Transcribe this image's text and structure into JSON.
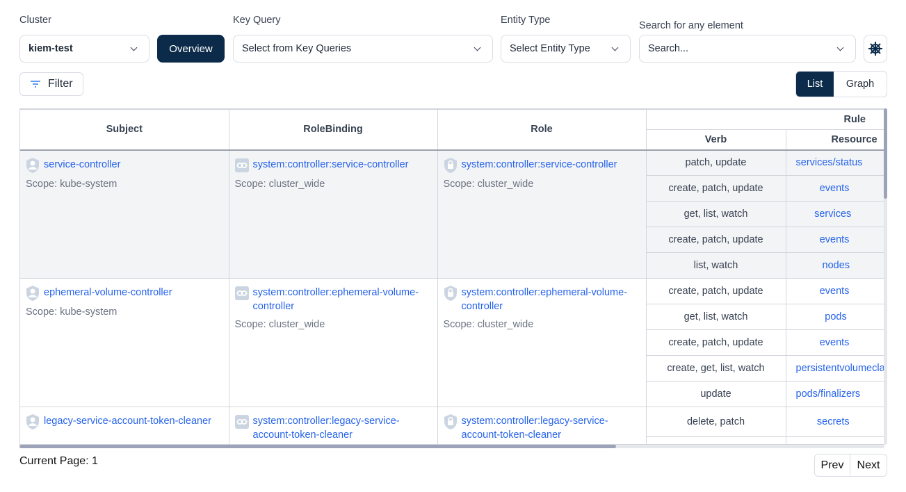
{
  "filters": {
    "cluster": {
      "label": "Cluster",
      "value": "kiem-test"
    },
    "overview_label": "Overview",
    "key_query": {
      "label": "Key Query",
      "placeholder": "Select from Key Queries"
    },
    "entity_type": {
      "label": "Entity Type",
      "placeholder": "Select Entity Type"
    },
    "search": {
      "label": "Search for any element",
      "placeholder": "Search..."
    },
    "helm_icon": "kubernetes-helm-icon"
  },
  "toolbar": {
    "filter_label": "Filter",
    "view_list": "List",
    "view_graph": "Graph",
    "active_view": "List"
  },
  "table": {
    "headers": {
      "subject": "Subject",
      "rolebinding": "RoleBinding",
      "role": "Role",
      "rule": "Rule",
      "verb": "Verb",
      "resource": "Resource"
    },
    "groups": [
      {
        "subject": "service-controller",
        "subject_scope": "Scope: kube-system",
        "rolebinding": "system:controller:service-controller",
        "rolebinding_scope": "Scope: cluster_wide",
        "role": "system:controller:service-controller",
        "role_scope": "Scope: cluster_wide",
        "rules": [
          {
            "verb": "patch, update",
            "resource": "services/status"
          },
          {
            "verb": "create, patch, update",
            "resource": "events"
          },
          {
            "verb": "get, list, watch",
            "resource": "services"
          },
          {
            "verb": "create, patch, update",
            "resource": "events"
          },
          {
            "verb": "list, watch",
            "resource": "nodes"
          }
        ]
      },
      {
        "subject": "ephemeral-volume-controller",
        "subject_scope": "Scope: kube-system",
        "rolebinding": "system:controller:ephemeral-volume-controller",
        "rolebinding_scope": "Scope: cluster_wide",
        "role": "system:controller:ephemeral-volume-controller",
        "role_scope": "Scope: cluster_wide",
        "rules": [
          {
            "verb": "create, patch, update",
            "resource": "events"
          },
          {
            "verb": "get, list, watch",
            "resource": "pods"
          },
          {
            "verb": "create, patch, update",
            "resource": "events"
          },
          {
            "verb": "create, get, list, watch",
            "resource": "persistentvolumeclaims"
          },
          {
            "verb": "update",
            "resource": "pods/finalizers"
          }
        ]
      },
      {
        "subject": "legacy-service-account-token-cleaner",
        "rolebinding": "system:controller:legacy-service-account-token-cleaner",
        "role": "system:controller:legacy-service-account-token-cleaner",
        "rules": [
          {
            "verb": "delete, patch",
            "resource": "secrets"
          },
          {
            "verb": "",
            "resource": ""
          }
        ]
      }
    ]
  },
  "pagination": {
    "current_page": "Current Page: 1",
    "prev": "Prev",
    "next": "Next"
  }
}
